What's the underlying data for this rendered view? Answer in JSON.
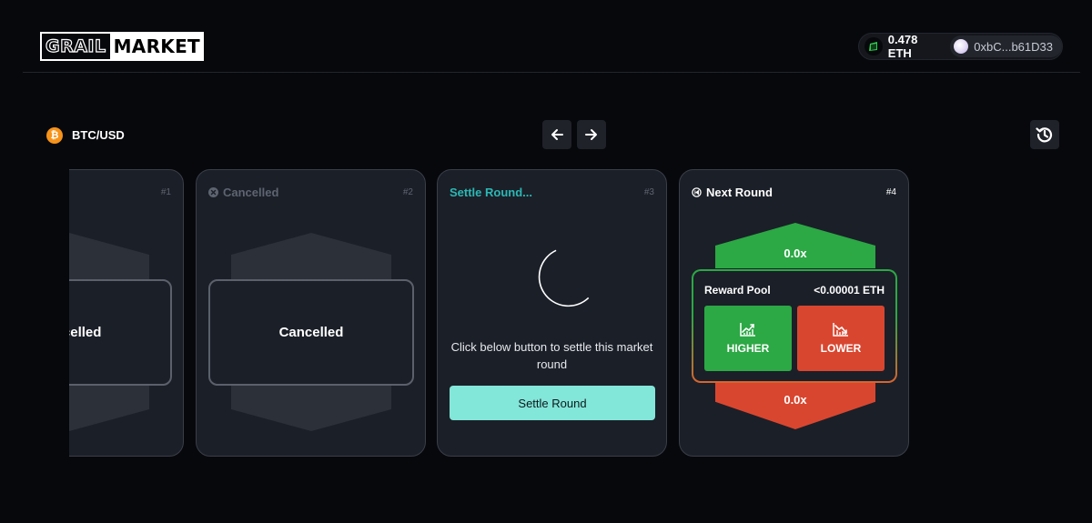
{
  "header": {
    "logo": {
      "part1": "GRAIL",
      "part2": "MARKET"
    },
    "wallet": {
      "balance": "0.478 ETH",
      "address": "0xbC...b61D33",
      "balance_icon": "wallet-icon"
    }
  },
  "toolbar": {
    "pair_label": "BTC/USD",
    "pair_icon_glyph": "₿",
    "prev_icon": "arrow-left-icon",
    "next_icon": "arrow-right-icon",
    "history_icon": "history-icon"
  },
  "rounds": [
    {
      "title": "",
      "number": "#1",
      "status": "Cancelled",
      "label": "Cancelled"
    },
    {
      "title": "Cancelled",
      "number": "#2",
      "status": "Cancelled",
      "label": "Cancelled"
    },
    {
      "title": "Settle Round...",
      "number": "#3",
      "message": "Click below button to settle this market round",
      "button": "Settle Round"
    },
    {
      "title": "Next Round",
      "number": "#4",
      "up_payout": "0.0x",
      "down_payout": "0.0x",
      "pool_label": "Reward Pool",
      "pool_value": "<0.00001 ETH",
      "higher_label": "HIGHER",
      "lower_label": "LOWER"
    }
  ],
  "colors": {
    "background": "#07080c",
    "card": "#1b1f28",
    "up": "#2ca845",
    "down": "#d9462f",
    "settle_button": "#82e6d9",
    "settle_title": "#2bb8b4",
    "btc": "#f7931a"
  }
}
